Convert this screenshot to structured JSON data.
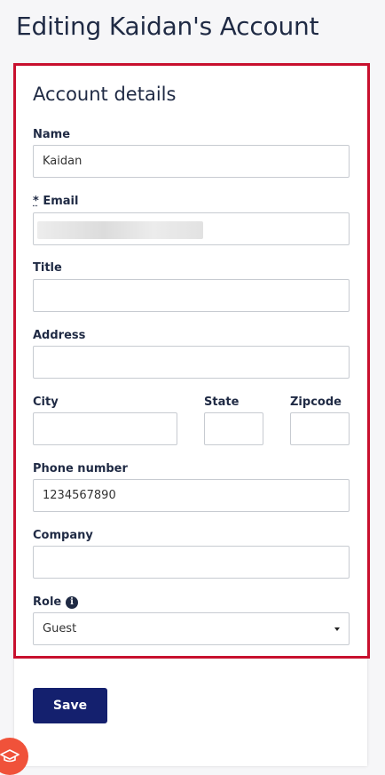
{
  "page": {
    "title": "Editing Kaidan's Account"
  },
  "form": {
    "section_title": "Account details",
    "name": {
      "label": "Name",
      "value": "Kaidan"
    },
    "email": {
      "required_marker": "*",
      "label": "Email",
      "value": ""
    },
    "title": {
      "label": "Title",
      "value": ""
    },
    "address": {
      "label": "Address",
      "value": ""
    },
    "city": {
      "label": "City",
      "value": ""
    },
    "state": {
      "label": "State",
      "value": ""
    },
    "zipcode": {
      "label": "Zipcode",
      "value": ""
    },
    "phone": {
      "label": "Phone number",
      "value": "1234567890"
    },
    "company": {
      "label": "Company",
      "value": ""
    },
    "role": {
      "label": "Role",
      "selected": "Guest",
      "info_icon": "info-icon"
    },
    "save_label": "Save"
  },
  "colors": {
    "highlight": "#c8102e",
    "primary_button": "#14206e",
    "help_badge": "#f0523a"
  }
}
